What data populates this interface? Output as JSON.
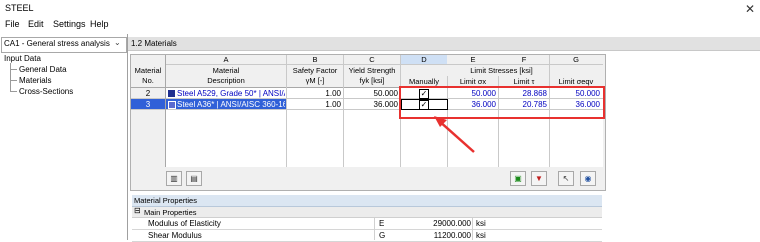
{
  "app": {
    "title": "STEEL",
    "close_glyph": "✕"
  },
  "menu": [
    "File",
    "Edit",
    "Settings",
    "Help"
  ],
  "case_selector": {
    "value": "CA1 - General stress analysis o",
    "chevron": "⌄"
  },
  "tree": {
    "root": "Input Data",
    "items": [
      "General Data",
      "Materials",
      "Cross-Sections"
    ]
  },
  "section_title": "1.2 Materials",
  "table": {
    "col_letters": [
      "A",
      "B",
      "C",
      "D",
      "E",
      "F",
      "G"
    ],
    "header": {
      "material_no": [
        "Material",
        "No."
      ],
      "material": "Material",
      "description": "Description",
      "safety_factor": "Safety Factor",
      "safety_sym": "γM [-]",
      "yield_strength": "Yield Strength",
      "yield_sym": "fyk [ksi]",
      "limit_stresses": "Limit Stresses [ksi]",
      "manually": "Manually",
      "limit_sx": "Limit σx",
      "limit_tau": "Limit τ",
      "limit_seqv": "Limit σeqv"
    },
    "rows": [
      {
        "no": "2",
        "description": "Steel A529, Grade 50* | ANSI/A",
        "safety": "1.00",
        "yield": "50.000",
        "manual": true,
        "sx": "50.000",
        "tau": "28.868",
        "seqv": "50.000",
        "swatch": "#1f2f8f"
      },
      {
        "no": "3",
        "description": "Steel A36* | ANSI/AISC 360-16:",
        "safety": "1.00",
        "yield": "36.000",
        "manual": true,
        "sx": "36.000",
        "tau": "20.785",
        "seqv": "36.000",
        "swatch": "#5a6ad0"
      }
    ]
  },
  "properties": {
    "title": "Material Properties",
    "group": "Main Properties",
    "collapse_glyph": "⊟",
    "rows": [
      {
        "name": "Modulus of Elasticity",
        "symbol": "E",
        "value": "29000.000",
        "unit": "ksi"
      },
      {
        "name": "Shear Modulus",
        "symbol": "G",
        "value": "11200.000",
        "unit": "ksi"
      }
    ]
  },
  "colors": {
    "highlight": "#e8312f",
    "selection": "#3060d8",
    "row_text": "#0000c0"
  }
}
